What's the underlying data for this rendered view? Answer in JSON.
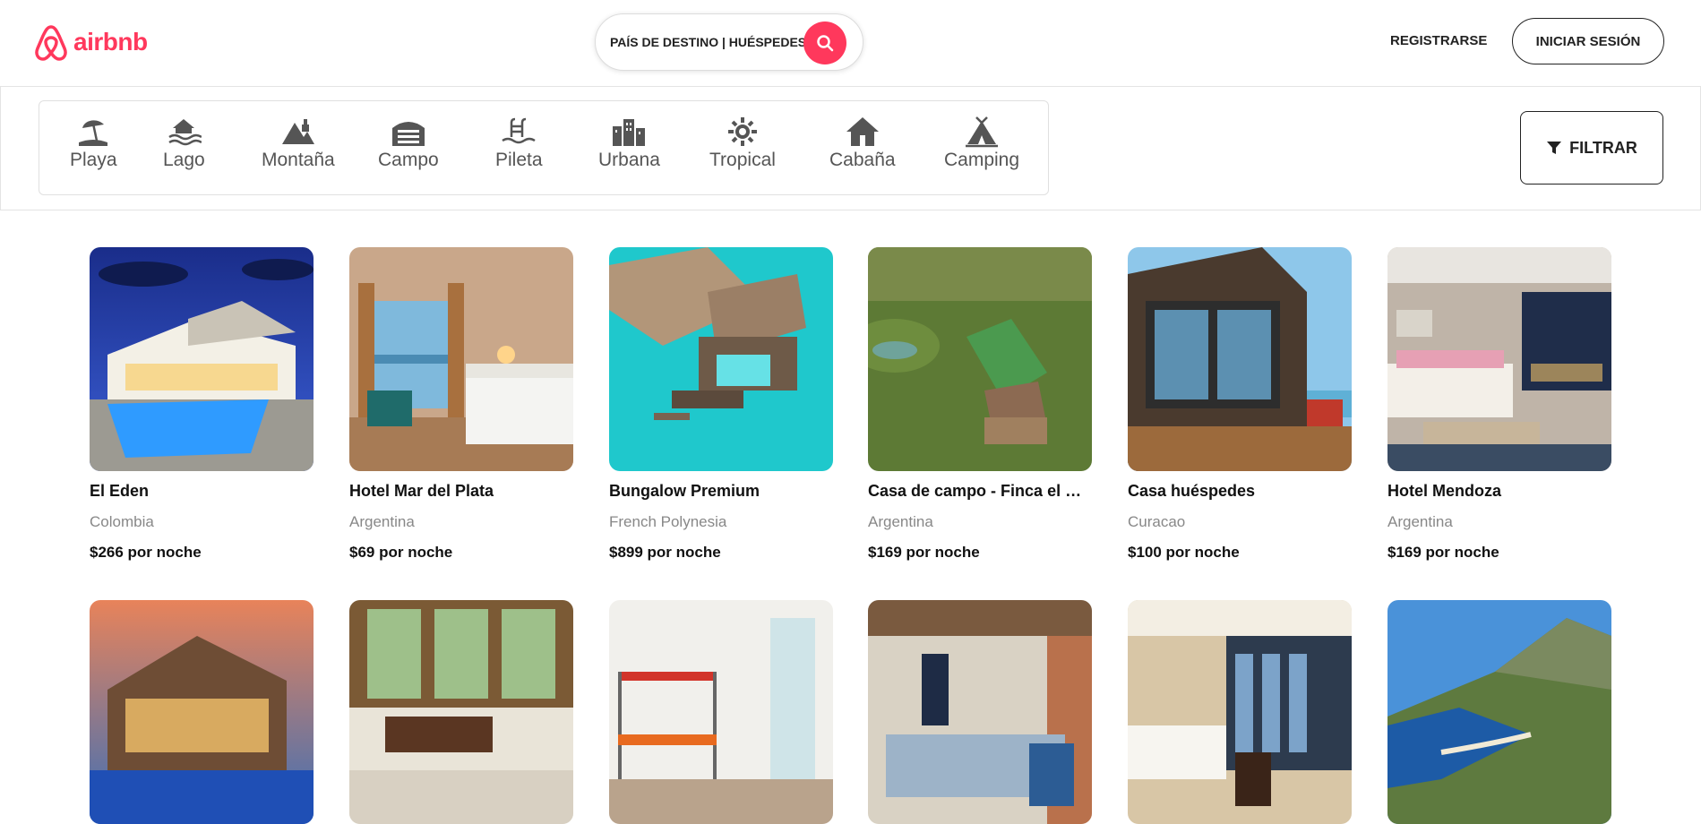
{
  "header": {
    "logo_text": "airbnb",
    "search_text": "PAÍS DE DESTINO | HUÉSPEDES",
    "register_label": "REGISTRARSE",
    "login_label": "INICIAR SESIÓN"
  },
  "colors": {
    "brand": "#ff385c",
    "text": "#222222",
    "muted": "#888888"
  },
  "categories": [
    {
      "label": "Playa",
      "icon": "beach-umbrella-icon"
    },
    {
      "label": "Lago",
      "icon": "lake-house-icon"
    },
    {
      "label": "Montaña",
      "icon": "mountain-icon"
    },
    {
      "label": "Campo",
      "icon": "barn-icon"
    },
    {
      "label": "Pileta",
      "icon": "pool-ladder-icon"
    },
    {
      "label": "Urbana",
      "icon": "city-buildings-icon"
    },
    {
      "label": "Tropical",
      "icon": "sun-icon"
    },
    {
      "label": "Cabaña",
      "icon": "house-icon"
    },
    {
      "label": "Camping",
      "icon": "tent-icon"
    }
  ],
  "filter_label": "FILTRAR",
  "listings": [
    {
      "title": "El Eden",
      "location": "Colombia",
      "price": "$266 por noche"
    },
    {
      "title": "Hotel Mar del Plata",
      "location": "Argentina",
      "price": "$69 por noche"
    },
    {
      "title": "Bungalow Premium",
      "location": "French Polynesia",
      "price": "$899 por noche"
    },
    {
      "title": "Casa de campo - Finca el Paso",
      "location": "Argentina",
      "price": "$169 por noche"
    },
    {
      "title": "Casa huéspedes",
      "location": "Curacao",
      "price": "$100 por noche"
    },
    {
      "title": "Hotel Mendoza",
      "location": "Argentina",
      "price": "$169 por noche"
    },
    {
      "title": "",
      "location": "",
      "price": ""
    },
    {
      "title": "",
      "location": "",
      "price": ""
    },
    {
      "title": "",
      "location": "",
      "price": ""
    },
    {
      "title": "",
      "location": "",
      "price": ""
    },
    {
      "title": "",
      "location": "",
      "price": ""
    },
    {
      "title": "",
      "location": "",
      "price": ""
    }
  ]
}
